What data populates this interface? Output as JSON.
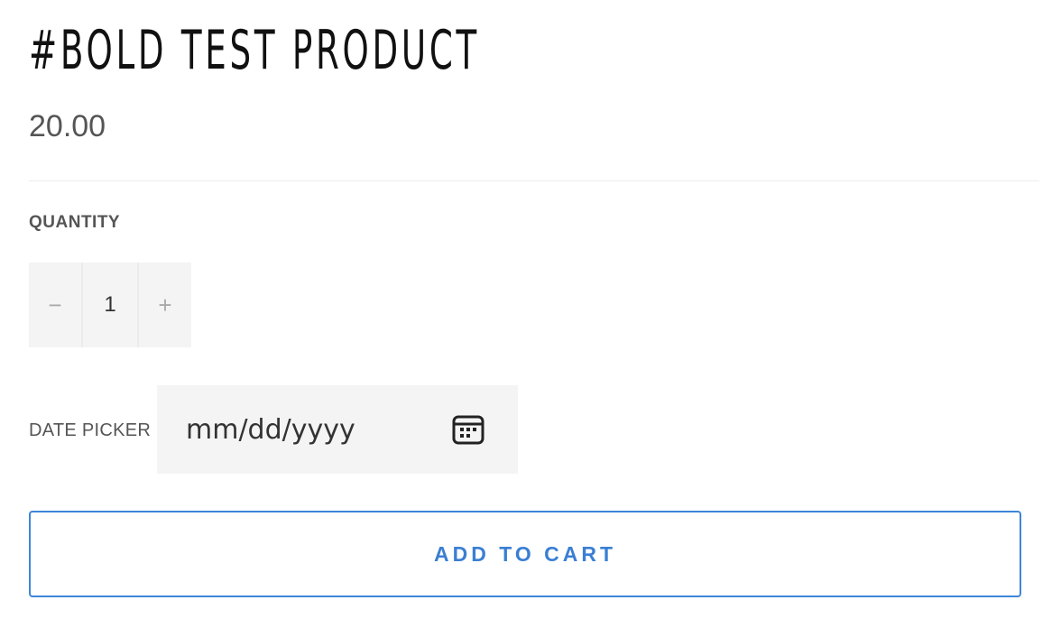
{
  "product": {
    "title": "#BOLD TEST PRODUCT",
    "price": "20.00"
  },
  "quantity": {
    "label": "QUANTITY",
    "decrement_symbol": "−",
    "value": "1",
    "increment_symbol": "+"
  },
  "date_picker": {
    "label": "DATE PICKER",
    "placeholder": "mm/dd/yyyy",
    "icon": "calendar-icon"
  },
  "actions": {
    "add_to_cart_label": "ADD TO CART"
  },
  "colors": {
    "accent": "#3a7fd3",
    "field_background": "#f4f4f4",
    "muted_text": "#555555"
  }
}
